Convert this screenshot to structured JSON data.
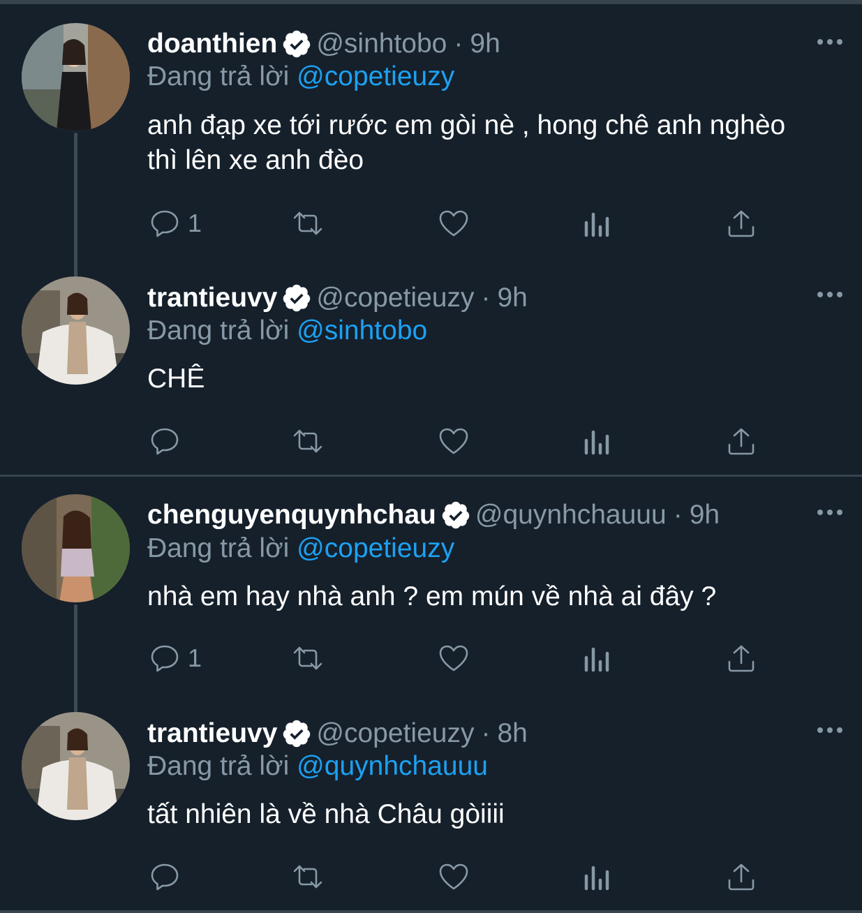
{
  "tweets": [
    {
      "name": "doanthien",
      "handle": "@sinhtobo",
      "time": "9h",
      "reply_prefix": "Đang trả lời",
      "reply_to": "@copetieuzy",
      "text": "anh đạp xe tới rước em gòi nè , hong chê anh nghèo thì lên xe anh đèo",
      "reply_count": "1"
    },
    {
      "name": "trantieuvy",
      "handle": "@copetieuzy",
      "time": "9h",
      "reply_prefix": "Đang trả lời",
      "reply_to": "@sinhtobo",
      "text": "CHÊ",
      "reply_count": ""
    },
    {
      "name": "chenguyenquynhchau",
      "handle": "@quynhchauuu",
      "time": "9h",
      "reply_prefix": "Đang trả lời",
      "reply_to": "@copetieuzy",
      "text": "nhà em hay nhà anh ? em mún về nhà ai đây ?",
      "reply_count": "1"
    },
    {
      "name": "trantieuvy",
      "handle": "@copetieuzy",
      "time": "8h",
      "reply_prefix": "Đang trả lời",
      "reply_to": "@quynhchauuu",
      "text": "tất nhiên là về nhà Châu gòiiii",
      "reply_count": ""
    }
  ],
  "separator_dot": "·",
  "colors": {
    "background": "#15202b",
    "muted": "#8899a6",
    "link": "#1da1f2",
    "divider": "#38444d"
  }
}
